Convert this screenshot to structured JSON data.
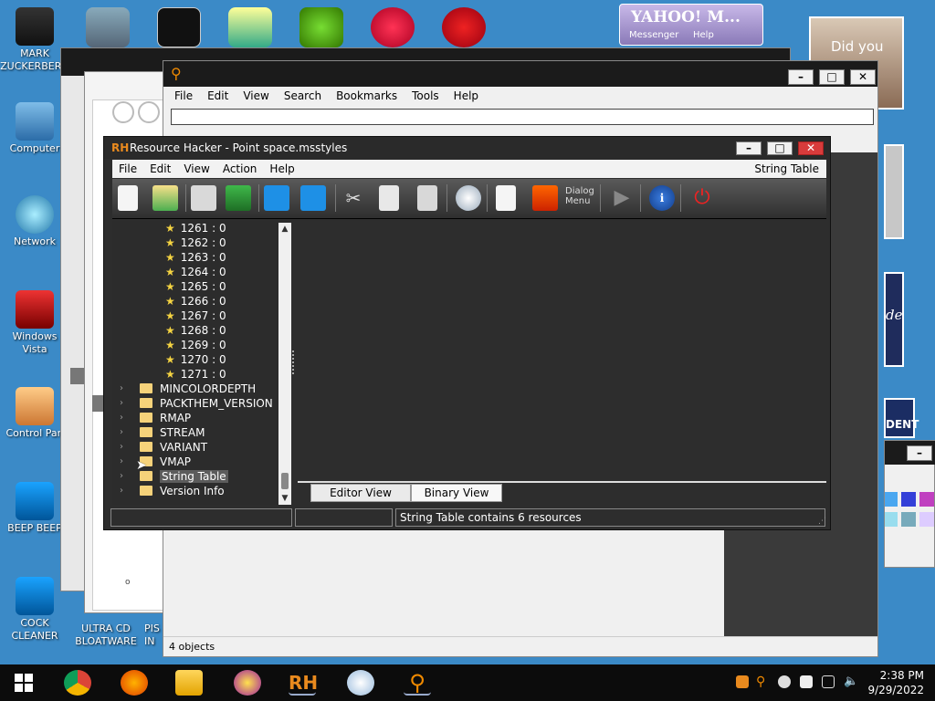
{
  "desktop": {
    "icons": [
      {
        "label": "MARK ZUCKERBERG"
      },
      {
        "label": "Computer"
      },
      {
        "label": "Network"
      },
      {
        "label": "Windows Vista"
      },
      {
        "label": "Control Pan"
      },
      {
        "label": "BEEP BEEP"
      },
      {
        "label": "COCK CLEANER"
      },
      {
        "label": "ULTRA CD BLOATWARE"
      },
      {
        "label": "PIS IN"
      }
    ],
    "yahoo_widget": {
      "title": "YAHOO! M...",
      "sub1": "Messenger",
      "sub2": "Help"
    },
    "side_text": {
      "did_you": "Did you",
      "de": "de",
      "dent": "DENT"
    }
  },
  "search_window": {
    "menu": [
      "File",
      "Edit",
      "View",
      "Search",
      "Bookmarks",
      "Tools",
      "Help"
    ],
    "status": "4 objects",
    "glyph": "o"
  },
  "rh": {
    "title": "Resource Hacker - Point space.msstyles",
    "logo": "RH",
    "menu": [
      "File",
      "Edit",
      "View",
      "Action",
      "Help"
    ],
    "menu_right": "String Table",
    "toolbar_dialog_label": "Dialog Menu",
    "tree_items": [
      "1261 : 0",
      "1262 : 0",
      "1263 : 0",
      "1264 : 0",
      "1265 : 0",
      "1266 : 0",
      "1267 : 0",
      "1268 : 0",
      "1269 : 0",
      "1270 : 0",
      "1271 : 0"
    ],
    "folders": [
      "MINCOLORDEPTH",
      "PACKTHEM_VERSION",
      "RMAP",
      "STREAM",
      "VARIANT",
      "VMAP",
      "String Table",
      "Version Info"
    ],
    "tabs": {
      "editor": "Editor View",
      "binary": "Binary View"
    },
    "status_msg": "String Table contains 6 resources"
  },
  "taskbar": {
    "time": "2:38 PM",
    "date": "9/29/2022"
  }
}
